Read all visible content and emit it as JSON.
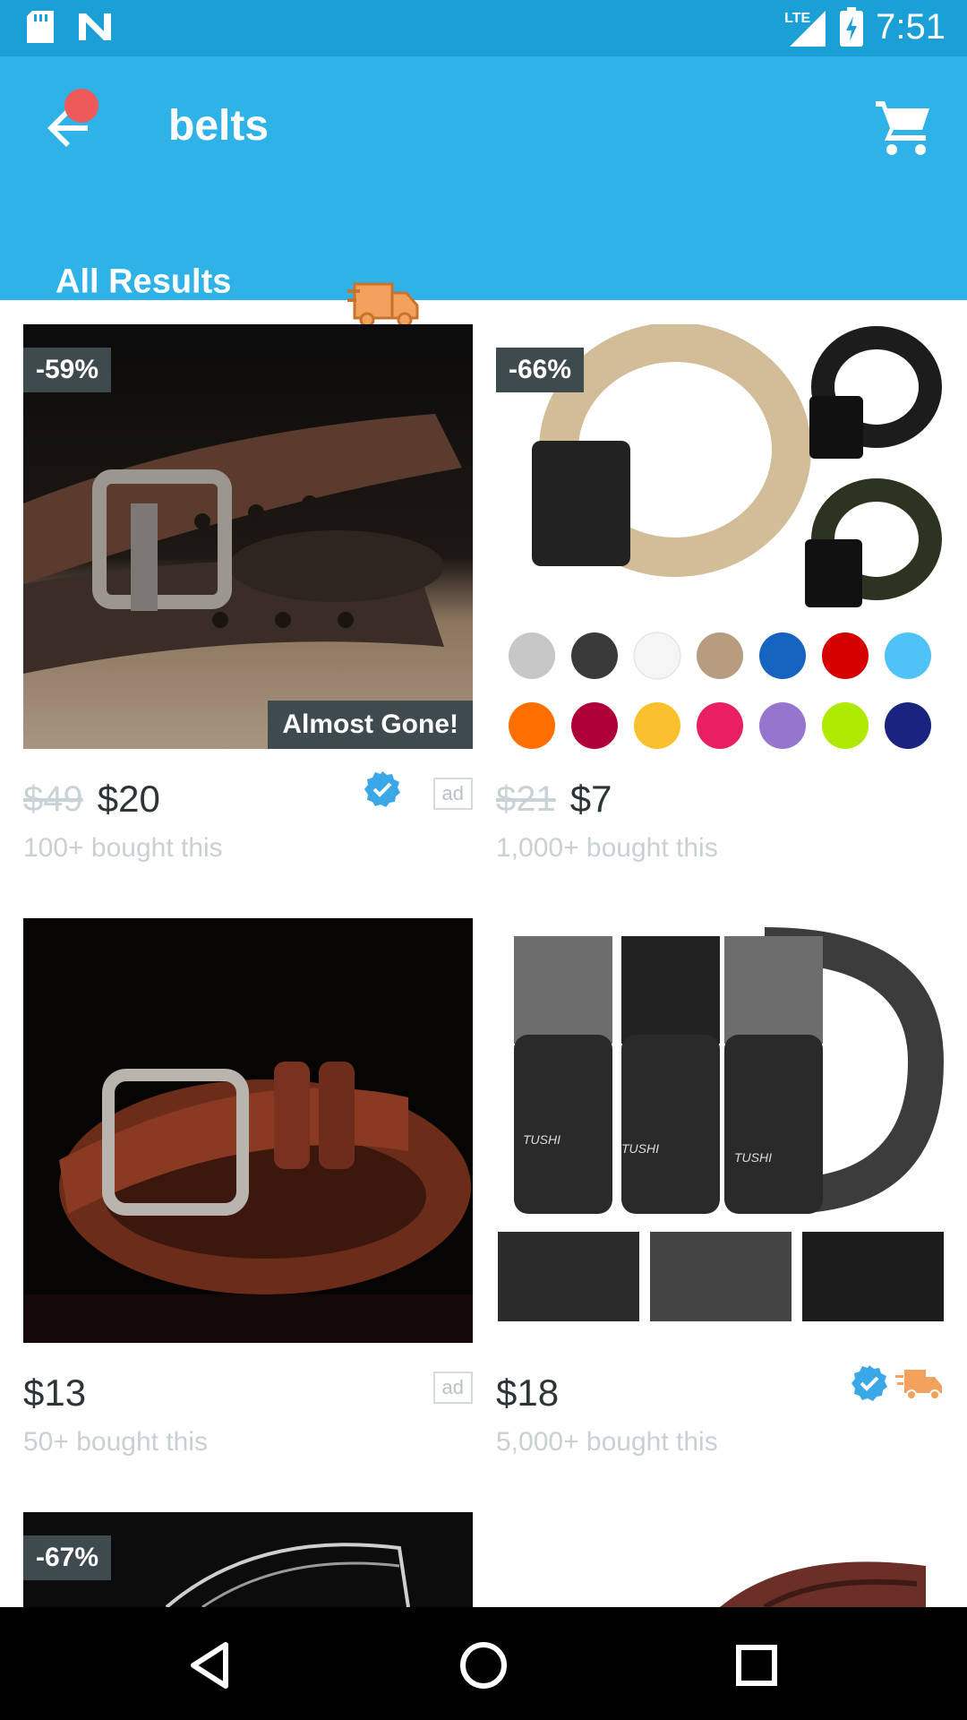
{
  "status_bar": {
    "time": "7:51",
    "network": "LTE",
    "icons": [
      "sd-card-icon",
      "notification-n-icon",
      "signal-icon",
      "battery-charging-icon"
    ]
  },
  "app_bar": {
    "title": "belts",
    "back_icon": "back-arrow-icon",
    "cart_icon": "cart-icon",
    "accent": "#2fb2e8"
  },
  "tabs": [
    {
      "label": "All Results",
      "selected": true
    },
    {
      "icon": "fast-shipping-truck-icon",
      "selected": false
    }
  ],
  "products": [
    {
      "discount": "-59%",
      "old_price": "$49",
      "price": "$20",
      "bought": "100+ bought this",
      "badge": "Almost Gone!",
      "verified": true,
      "ad": "ad"
    },
    {
      "discount": "-66%",
      "old_price": "$21",
      "price": "$7",
      "bought": "1,000+ bought this"
    },
    {
      "price": "$13",
      "bought": "50+ bought this",
      "ad": "ad"
    },
    {
      "price": "$18",
      "bought": "5,000+ bought this",
      "verified": true,
      "fast_shipping": true
    },
    {
      "discount": "-67%"
    },
    {}
  ],
  "image_text": {
    "brand": "TUSHI"
  },
  "nav_bar": {
    "icons": [
      "back-triangle-icon",
      "home-circle-icon",
      "recents-square-icon"
    ]
  }
}
